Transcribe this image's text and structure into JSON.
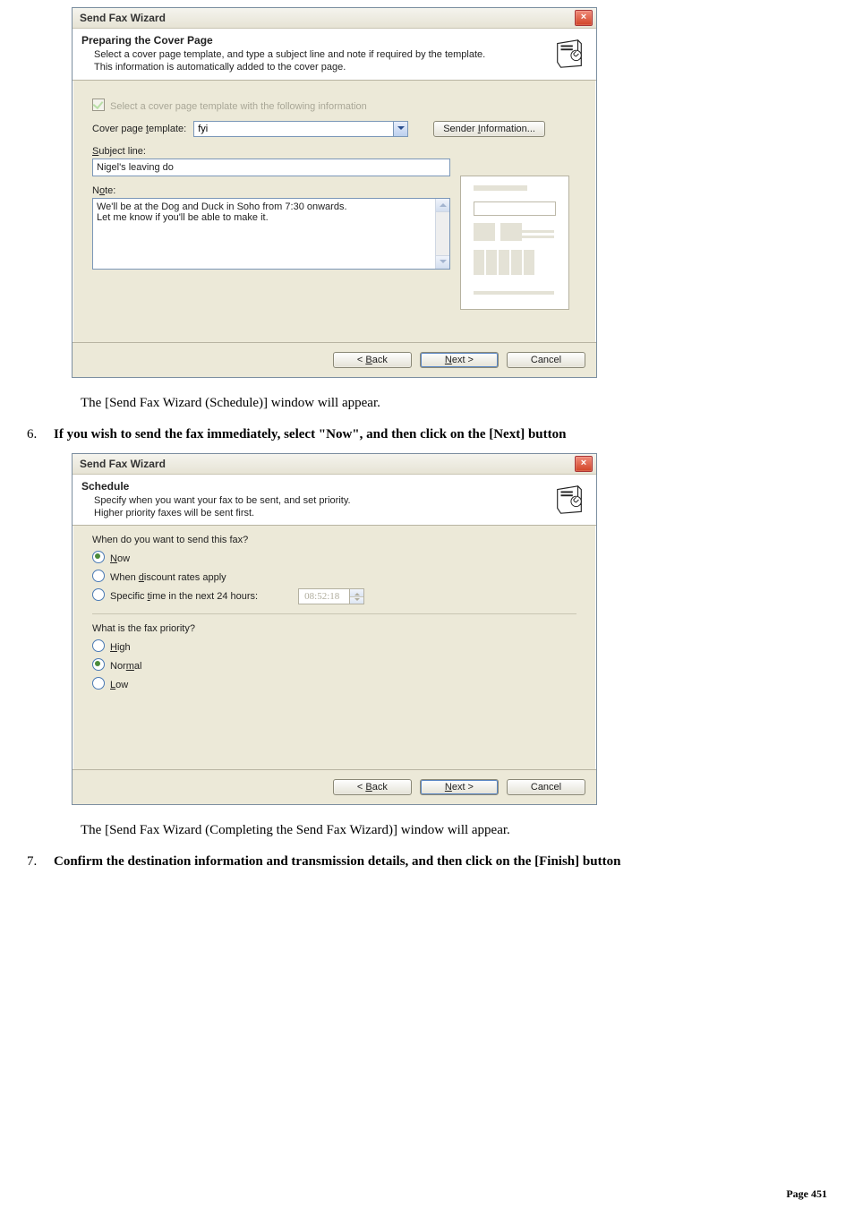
{
  "wiz1": {
    "titlebar": "Send Fax Wizard",
    "close": "×",
    "header_title": "Preparing the Cover Page",
    "header_sub": "Select a cover page template, and type a subject line and note if required by the template.\nThis information is automatically added to the cover page.",
    "chk_label": "Select a cover page template with the following information",
    "cpt_label": "Cover page template:",
    "cpt_value": "fyi",
    "sender_btn": "Sender Information...",
    "subject_label": "Subject line:",
    "subject_value": "Nigel's leaving do",
    "note_label": "Note:",
    "note_value": "We'll be at the Dog and Duck in Soho from 7:30 onwards.\nLet me know if you'll be able to make it.",
    "btn_back": "< Back",
    "btn_next": "Next >",
    "btn_cancel": "Cancel"
  },
  "text1": "The [Send Fax Wizard (Schedule)] window will appear.",
  "step6": {
    "num": "6.",
    "text": "If you wish to send the fax immediately, select \"Now\", and then click on the [Next] button"
  },
  "wiz2": {
    "titlebar": "Send Fax Wizard",
    "close": "×",
    "header_title": "Schedule",
    "header_sub": "Specify when you want your fax to be sent, and set priority.\nHigher priority faxes will be sent first.",
    "q1": "When do you want to send this fax?",
    "opt_now": "Now",
    "opt_discount": "When discount rates apply",
    "opt_specific": "Specific time in the next 24 hours:",
    "time_value": "08:52:18",
    "q2": "What is the fax priority?",
    "opt_high": "High",
    "opt_normal": "Normal",
    "opt_low": "Low",
    "btn_back": "< Back",
    "btn_next": "Next >",
    "btn_cancel": "Cancel"
  },
  "text2": "The [Send Fax Wizard (Completing the Send Fax Wizard)] window will appear.",
  "step7": {
    "num": "7.",
    "text": "Confirm the destination information and transmission details, and then click on the [Finish] button"
  },
  "footer": "Page 451"
}
